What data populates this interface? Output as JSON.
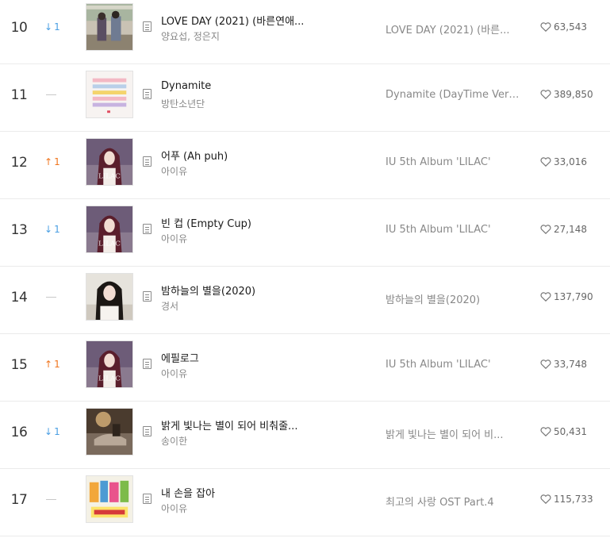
{
  "rows": [
    {
      "rank": "10",
      "change_dir": "down",
      "change_arrow": "↓",
      "change_value": "1",
      "cover": "lovebirds-cover",
      "title": "LOVE DAY (2021) (바른연애...",
      "artist": "양요섭, 정은지",
      "album": "LOVE DAY (2021) (바른...",
      "likes": "63,543"
    },
    {
      "rank": "11",
      "change_dir": "same",
      "change_arrow": "",
      "change_value": "",
      "cover": "dynamite-cover",
      "title": "Dynamite",
      "artist": "방탄소년단",
      "album": "Dynamite (DayTime Versi...",
      "likes": "389,850"
    },
    {
      "rank": "12",
      "change_dir": "up",
      "change_arrow": "↑",
      "change_value": "1",
      "cover": "lilac-cover",
      "title": "어푸 (Ah puh)",
      "artist": "아이유",
      "album": "IU 5th Album 'LILAC'",
      "likes": "33,016"
    },
    {
      "rank": "13",
      "change_dir": "down",
      "change_arrow": "↓",
      "change_value": "1",
      "cover": "lilac-cover",
      "title": "빈 컵 (Empty Cup)",
      "artist": "아이유",
      "album": "IU 5th Album 'LILAC'",
      "likes": "27,148"
    },
    {
      "rank": "14",
      "change_dir": "same",
      "change_arrow": "",
      "change_value": "",
      "cover": "stars-cover",
      "title": "밤하늘의 별을(2020)",
      "artist": "경서",
      "album": "밤하늘의 별을(2020)",
      "likes": "137,790"
    },
    {
      "rank": "15",
      "change_dir": "up",
      "change_arrow": "↑",
      "change_value": "1",
      "cover": "lilac-cover",
      "title": "에필로그",
      "artist": "아이유",
      "album": "IU 5th Album 'LILAC'",
      "likes": "33,748"
    },
    {
      "rank": "16",
      "change_dir": "down",
      "change_arrow": "↓",
      "change_value": "1",
      "cover": "shine-cover",
      "title": "밝게 빛나는 별이 되어 비춰줄...",
      "artist": "송이한",
      "album": "밝게 빛나는 별이 되어 비...",
      "likes": "50,431"
    },
    {
      "rank": "17",
      "change_dir": "same",
      "change_arrow": "",
      "change_value": "",
      "cover": "bestlove-cover",
      "title": "내 손을 잡아",
      "artist": "아이유",
      "album": "최고의 사랑 OST Part.4",
      "likes": "115,733"
    }
  ],
  "colors": {
    "down": "#4a9fe3",
    "up": "#f0751e",
    "text_primary": "#1a1a1a",
    "text_secondary": "#888888",
    "divider": "#ebebeb"
  },
  "icons": {
    "lyrics": "lyrics-icon",
    "like": "heart-icon"
  }
}
